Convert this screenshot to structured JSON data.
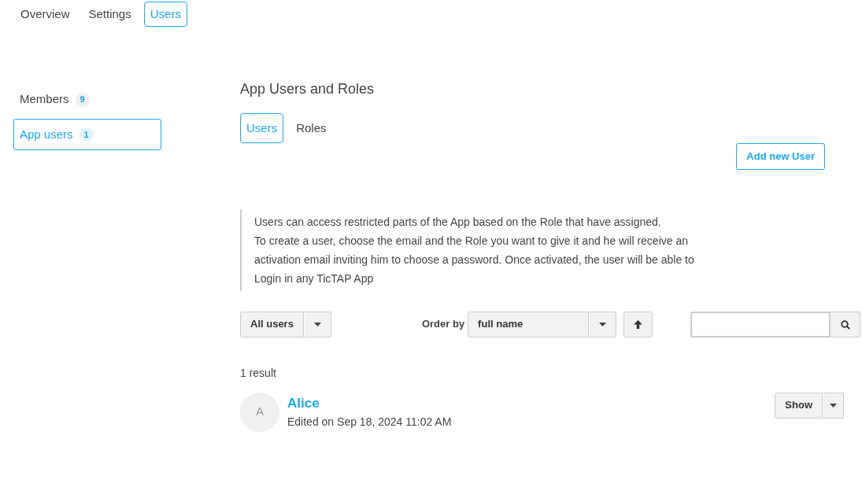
{
  "top_tabs": [
    {
      "label": "Overview",
      "selected": false
    },
    {
      "label": "Settings",
      "selected": false
    },
    {
      "label": "Users",
      "selected": true
    }
  ],
  "sidebar": {
    "items": [
      {
        "label": "Members",
        "count": "9",
        "selected": false
      },
      {
        "label": "App users",
        "count": "1",
        "selected": true
      }
    ]
  },
  "main": {
    "title": "App Users and Roles",
    "tabs": [
      {
        "label": "Users",
        "selected": true
      },
      {
        "label": "Roles",
        "selected": false
      }
    ],
    "add_button": "Add new User",
    "description": [
      "Users can access restricted parts of the App based on the Role that have assigned.",
      "To create a user, choose the email and the Role you want to give it and he will receive an activation email inviting him to choose a password. Once activated, the user will be able to Login in any TicTAP App"
    ],
    "filter": "All users",
    "order_label": "Order by",
    "order_value": "full name",
    "result_count": "1 result",
    "users": [
      {
        "initial": "A",
        "name": "Alice",
        "edited": "Edited on Sep 18, 2024 11:02 AM",
        "action": "Show"
      }
    ]
  }
}
